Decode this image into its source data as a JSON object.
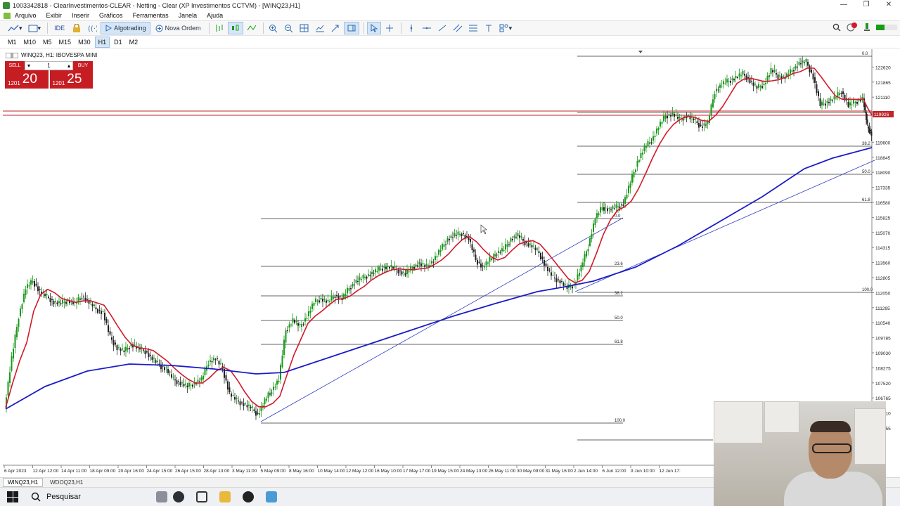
{
  "window": {
    "title": "1003342818 - ClearInvestimentos-CLEAR - Netting - Clear (XP Investimentos CCTVM) - [WINQ23,H1]"
  },
  "menu": [
    "Arquivo",
    "Exibir",
    "Inserir",
    "Gráficos",
    "Ferramentas",
    "Janela",
    "Ajuda"
  ],
  "toolbar": {
    "ide_label": "IDE",
    "algotrading_label": "Algotrading",
    "nova_ordem_label": "Nova Ordem"
  },
  "timeframes": [
    "M1",
    "M10",
    "M5",
    "M15",
    "M30",
    "H1",
    "D1",
    "M2"
  ],
  "active_timeframe": "H1",
  "chart": {
    "symbol_label": "WINQ23, H1:  IBOVESPA MINI",
    "trade": {
      "sell_label": "SELL",
      "buy_label": "BUY",
      "quantity": "1",
      "bid_prefix": "1201",
      "bid_big": "20",
      "ask_prefix": "1201",
      "ask_big": "25"
    },
    "price_levels": [
      "122620",
      "122620",
      "121865",
      "121110",
      "120355",
      "119926",
      "119600",
      "118845",
      "118090",
      "117335",
      "116580",
      "115825",
      "115070",
      "114315",
      "113560",
      "112805",
      "112050",
      "111295",
      "110540",
      "109785",
      "109030",
      "108275",
      "107520",
      "106765",
      "106010",
      "105255"
    ],
    "time_labels": [
      "6 Apr 2023",
      "12 Apr 12:00",
      "14 Apr 11:00",
      "18 Apr 09:00",
      "20 Apr 16:00",
      "24 Apr 15:00",
      "26 Apr 15:00",
      "28 Apr 13:00",
      "3 May 11:00",
      "5 May 09:00",
      "8 May 16:00",
      "10 May 14:00",
      "12 May 12:00",
      "16 May 10:00",
      "17 May 17:00",
      "19 May 15:00",
      "24 May 13:00",
      "26 May 11:00",
      "30 May 09:00",
      "31 May 16:00",
      "2 Jun 14:00",
      "6 Jun 12:00",
      "9 Jun 10:00",
      "12 Jun 17:"
    ],
    "fib_labels_left": [
      "0.0",
      "23.6",
      "38.2",
      "50.0",
      "61.8",
      "100.0"
    ],
    "fib_labels_right": [
      "0.0",
      "38.2",
      "50.0",
      "61.8",
      "100.0"
    ],
    "colors": {
      "candle_up": "#1a9a1a",
      "candle_down": "#222222",
      "ma_fast": "#d11a2a",
      "ma_slow": "#1c1cc8",
      "trendline": "#2f3fc0",
      "fib": "#333333",
      "hline": "#c0262c"
    }
  },
  "chart_tabs": [
    "WINQ23,H1",
    "WDOQ23,H1"
  ],
  "taskbar": {
    "search_label": "Pesquisar"
  }
}
